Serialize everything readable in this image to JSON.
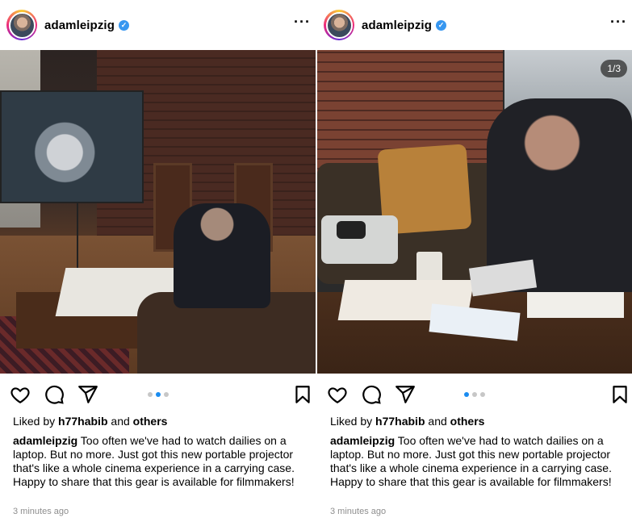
{
  "posts": [
    {
      "username": "adamleipzig",
      "verified": true,
      "more_label": "···",
      "carousel_counter": "",
      "active_dot": 1,
      "dot_count": 3,
      "liked_prefix": "Liked by ",
      "liked_user": "h77habib",
      "liked_and": " and ",
      "liked_others": "others",
      "caption_user": "adamleipzig",
      "caption_text": " Too often we've had to watch dailies on a laptop. But no more. Just got this new portable projector that's like a whole cinema experience in a carrying case. Happy to share that this gear is available for filmmakers!",
      "timestamp": "3 minutes ago"
    },
    {
      "username": "adamleipzig",
      "verified": true,
      "more_label": "···",
      "carousel_counter": "1/3",
      "active_dot": 0,
      "dot_count": 3,
      "liked_prefix": "Liked by ",
      "liked_user": "h77habib",
      "liked_and": " and ",
      "liked_others": "others",
      "caption_user": "adamleipzig",
      "caption_text": " Too often we've had to watch dailies on a laptop. But no more. Just got this new portable projector that's like a whole cinema experience in a carrying case. Happy to share that this gear is available for filmmakers!",
      "timestamp": "3 minutes ago"
    }
  ],
  "icons": {
    "like": "heart-icon",
    "comment": "comment-bubble-icon",
    "share": "paper-plane-icon",
    "save": "bookmark-icon",
    "verified": "verified-badge-icon",
    "more": "more-options-icon"
  },
  "colors": {
    "verified": "#3797f0",
    "active_dot": "#1a8cf0",
    "inactive_dot": "#c7c7c7",
    "timestamp": "#8e8e8e"
  }
}
